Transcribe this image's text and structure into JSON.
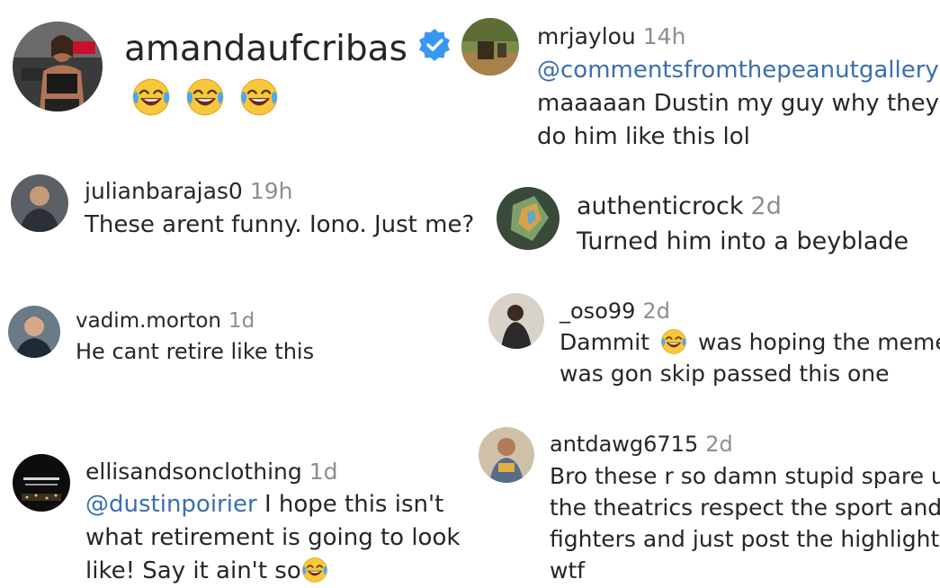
{
  "comments": [
    {
      "username": "amandaufcribas",
      "verified": true,
      "emoji_count": 3,
      "emoji": "face-with-tears-of-joy",
      "avatar_icon": "fighter-photo"
    },
    {
      "username": "mrjaylou",
      "time": "14h",
      "mention": "@commentsfromthepeanutgallery",
      "line1": "maaaaan Dustin my guy why they",
      "line2": "do him like this lol",
      "avatar_icon": "outdoor-photo"
    },
    {
      "username": "julianbarajas0",
      "time": "19h",
      "line1": "These arent funny. Iono. Just me?",
      "avatar_icon": "person-photo"
    },
    {
      "username": "authenticrock",
      "time": "2d",
      "line1": "Turned him into a beyblade",
      "avatar_icon": "gem-photo"
    },
    {
      "username": "vadim.morton",
      "time": "1d",
      "line1": "He cant retire like this",
      "avatar_icon": "person-photo"
    },
    {
      "username": "_oso99",
      "time": "2d",
      "line1_before": "Dammit",
      "line1_after": "was hoping the memes",
      "line2": "was gon skip passed this one",
      "avatar_icon": "person-photo"
    },
    {
      "username": "ellisandsonclothing",
      "time": "1d",
      "mention": "@dustinpoirier",
      "line1_rest": "I hope this isn't",
      "line2": "what retirement is going to look",
      "line3": "like! Say it ain't so",
      "avatar_icon": "brand-logo"
    },
    {
      "username": "antdawg6715",
      "time": "2d",
      "line1": "Bro these r so damn stupid spare us",
      "line2": "the theatrics respect the sport and",
      "line3": "fighters and just post the highlight",
      "line4": "wtf",
      "avatar_icon": "person-photo"
    }
  ],
  "colors": {
    "text": "#262626",
    "muted": "#8e8e8e",
    "mention": "#3b6fae",
    "verified": "#3897f0"
  }
}
